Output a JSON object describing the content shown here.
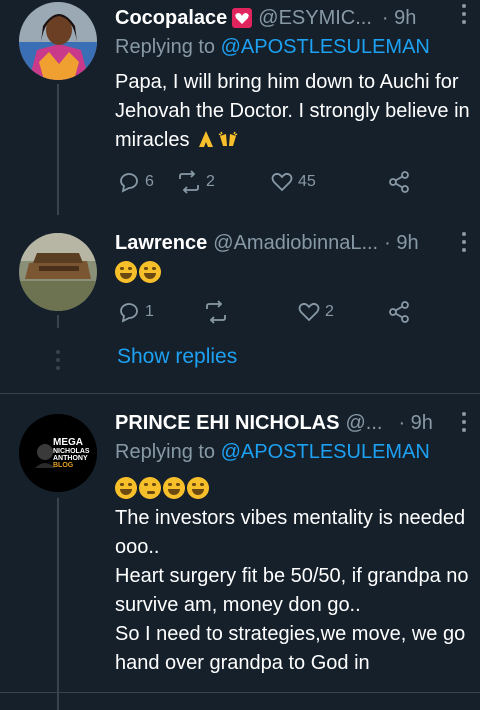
{
  "tweets": [
    {
      "name": "Cocopalace",
      "handle": "@ESYMIC...",
      "time": "· 9h",
      "replying_prefix": "Replying to",
      "replying_to": "@APOSTLESULEMAN",
      "text": "Papa, I will bring him down to Auchi for Jehovah the Doctor. I strongly believe in miracles",
      "emojis": [
        "folded-hands-emoji",
        "raising-hands-emoji"
      ],
      "replies": "6",
      "retweets": "2",
      "likes": "45"
    },
    {
      "name": "Lawrence",
      "handle": "@AmadiobinnaL...",
      "time": "· 9h",
      "emojis": [
        "rofl-emoji",
        "rofl-emoji"
      ],
      "replies": "1",
      "retweets": "",
      "likes": "2"
    },
    {
      "name": "PRINCE EHI NICHOLAS",
      "handle": "@...",
      "time": "· 9h",
      "replying_prefix": "Replying to",
      "replying_to": "@APOSTLESULEMAN",
      "emojis": [
        "rofl-emoji",
        "thinking-emoji",
        "rofl-emoji",
        "rofl-emoji"
      ],
      "lines": [
        "The investors vibes mentality is needed ooo..",
        "Heart surgery fit be 50/50, if grandpa no survive am, money don go..",
        "So I need to strategies,we move, we go hand over grandpa to God in"
      ],
      "avatar_text": {
        "line1": "MEGA",
        "line2": "NICHOLAS",
        "line3": "ANTHONY",
        "line4": "BLOG"
      }
    }
  ],
  "show_replies": "Show replies",
  "colors": {
    "background": "#15202b",
    "accent": "#1da1f2",
    "secondary": "#8899a6",
    "heart_badge": "#e0245e"
  }
}
